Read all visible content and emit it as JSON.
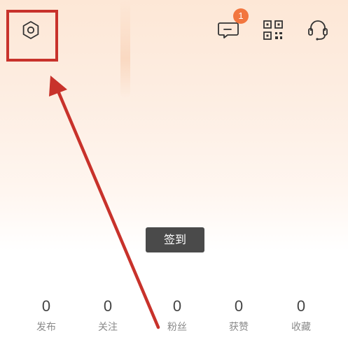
{
  "header": {
    "settings_icon": "settings-hexagon-icon",
    "message_icon": "message-icon",
    "message_badge": "1",
    "qr_icon": "qr-code-icon",
    "support_icon": "customer-service-icon"
  },
  "actions": {
    "sign_in_label": "签到"
  },
  "stats": [
    {
      "value": "0",
      "label": "发布"
    },
    {
      "value": "0",
      "label": "关注"
    },
    {
      "value": "0",
      "label": "粉丝"
    },
    {
      "value": "0",
      "label": "获赞"
    },
    {
      "value": "0",
      "label": "收藏"
    }
  ],
  "annotation": {
    "color": "#c8322b",
    "accent_orange": "#f2763f"
  }
}
